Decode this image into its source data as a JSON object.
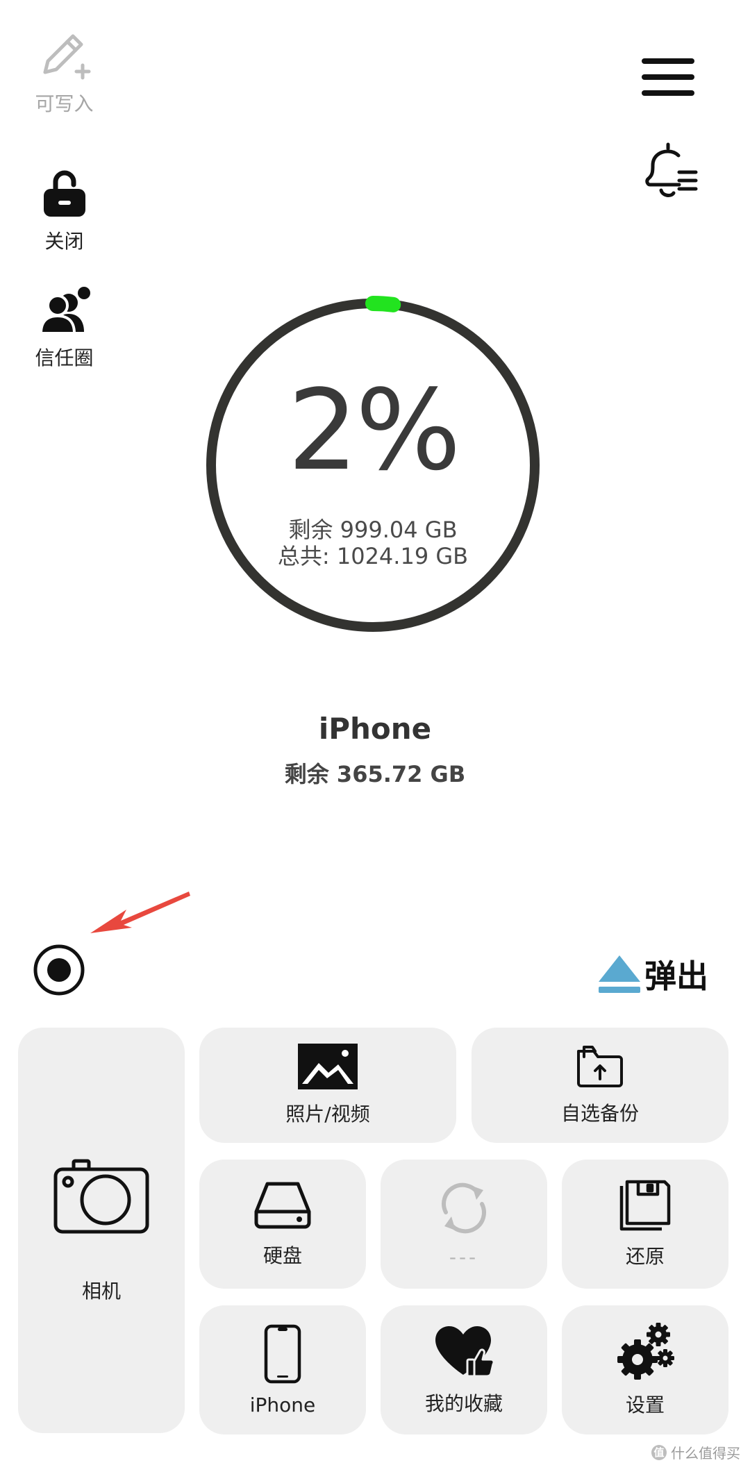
{
  "side": {
    "write": {
      "label": "可写入"
    },
    "lock": {
      "label": "关闭"
    },
    "trust": {
      "label": "信任圈"
    }
  },
  "storage": {
    "percent": "2%",
    "used_fraction": 0.02,
    "free_line": "剩余 999.04 GB",
    "total_line": "总共: 1024.19 GB"
  },
  "device": {
    "name": "iPhone",
    "free": "剩余 365.72 GB"
  },
  "eject": {
    "label": "弹出"
  },
  "tiles": {
    "camera": "相机",
    "photos": "照片/视频",
    "custom_backup": "自选备份",
    "disk": "硬盘",
    "sync": "---",
    "restore": "还原",
    "iphone": "iPhone",
    "favorites": "我的收藏",
    "settings": "设置"
  },
  "colors": {
    "ring_track": "#333330",
    "ring_progress": "#22e31f",
    "eject_icon": "#5aa9d0",
    "arrow": "#e8483e",
    "tile_bg": "#efefef"
  },
  "watermark": {
    "text": "什么值得买",
    "badge": "值"
  }
}
